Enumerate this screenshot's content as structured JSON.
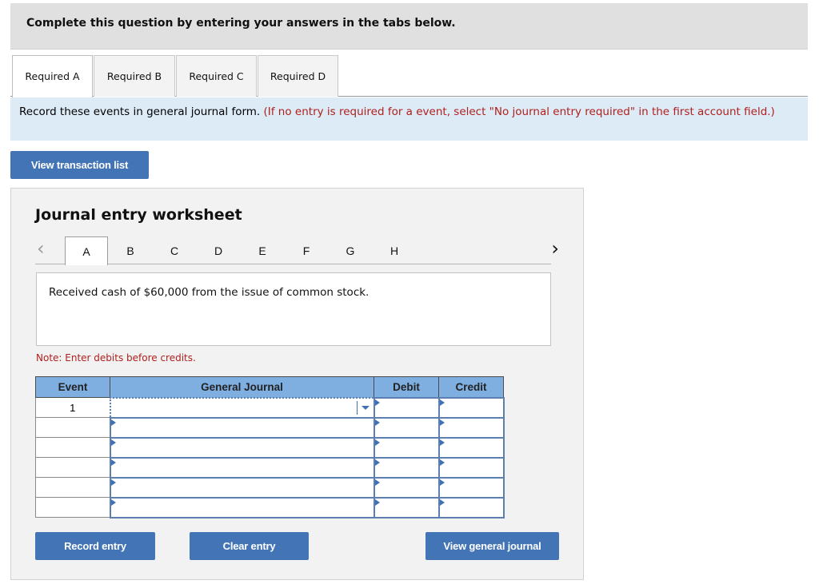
{
  "instruction_bar": {
    "text": "Complete this question by entering your answers in the tabs below."
  },
  "required_tabs": [
    {
      "label": "Required A",
      "active": true
    },
    {
      "label": "Required B",
      "active": false
    },
    {
      "label": "Required C",
      "active": false
    },
    {
      "label": "Required D",
      "active": false
    }
  ],
  "prompt": {
    "main": "Record these events in general journal form. ",
    "note": "(If no entry is required for a event, select \"No journal entry required\" in the first account field.)"
  },
  "buttons": {
    "view_transaction_list": "View transaction list",
    "record_entry": "Record entry",
    "clear_entry": "Clear entry",
    "view_general_journal": "View general journal"
  },
  "worksheet": {
    "title": "Journal entry worksheet",
    "nav": {
      "prev_icon": "chevron-left-icon",
      "next_icon": "chevron-right-icon",
      "prev_glyph": "‹",
      "next_glyph": "›"
    },
    "letters": [
      "A",
      "B",
      "C",
      "D",
      "E",
      "F",
      "G",
      "H"
    ],
    "active_letter": "A",
    "description": "Received cash of $60,000 from the issue of common stock.",
    "note": "Note: Enter debits before credits."
  },
  "journal_table": {
    "headers": {
      "event": "Event",
      "general_journal": "General Journal",
      "debit": "Debit",
      "credit": "Credit"
    },
    "rows": [
      {
        "event": "1",
        "account": "",
        "debit": "",
        "credit": ""
      },
      {
        "event": "",
        "account": "",
        "debit": "",
        "credit": ""
      },
      {
        "event": "",
        "account": "",
        "debit": "",
        "credit": ""
      },
      {
        "event": "",
        "account": "",
        "debit": "",
        "credit": ""
      },
      {
        "event": "",
        "account": "",
        "debit": "",
        "credit": ""
      },
      {
        "event": "",
        "account": "",
        "debit": "",
        "credit": ""
      }
    ]
  },
  "colors": {
    "accent_blue": "#4374b6",
    "header_blue": "#7faee0",
    "note_red": "#b0201c",
    "prompt_bg": "#ddebf7"
  }
}
